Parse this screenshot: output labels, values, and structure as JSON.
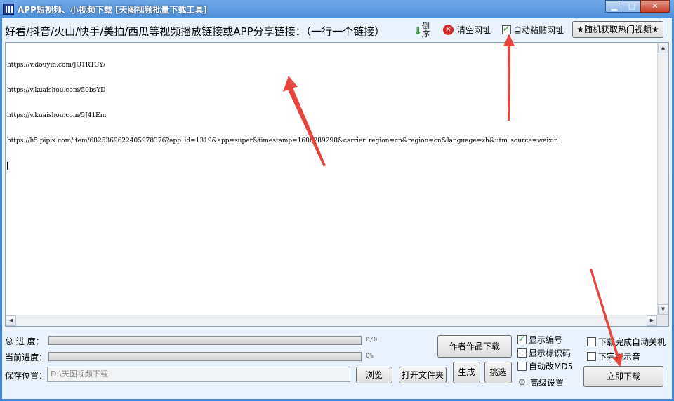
{
  "window": {
    "title": "APP短视频、小视频下载 [天图视频批量下载工具]"
  },
  "toolbar": {
    "prompt": "好看/抖音/火山/快手/美拍/西瓜等视频播放链接或APP分享链接：（一行一个链接）",
    "reverse_label": "倒序",
    "clear_label": "清空网址",
    "auto_paste_label": "自动粘贴网址",
    "auto_paste_checked": true,
    "hot_videos_label": "★随机获取热门视频★"
  },
  "links": [
    "https://v.douyin.com/JQ1RTCY/",
    "https://v.kuaishou.com/50bsYD",
    "https://v.kuaishou.com/5J41Em",
    "https://h5.pipix.com/item/6825369622405978376?app_id=1319&app=super&timestamp=1606289298&carrier_region=cn&region=cn&language=zh&utm_source=weixin"
  ],
  "progress": {
    "total_label": "总 进 度：",
    "total_value": "0/0",
    "total_fraction": 0,
    "current_label": "当前进度：",
    "current_value": "0%",
    "current_fraction": 0
  },
  "save": {
    "label": "保存位置：",
    "path": "D:\\天图视频下载",
    "browse_label": "浏览",
    "open_folder_label": "打开文件夹"
  },
  "actions": {
    "author_download_label": "作者作品下载",
    "generate_label": "生成",
    "pick_label": "挑选",
    "download_now_label": "立即下载"
  },
  "options": {
    "show_number_label": "显示编号",
    "show_number_checked": true,
    "show_id_label": "显示标识码",
    "show_id_checked": false,
    "auto_md5_label": "自动改MD5",
    "auto_md5_checked": false,
    "advanced_label": "高级设置",
    "shutdown_label": "下载完成自动关机",
    "shutdown_checked": false,
    "sound_label": "下完提示音",
    "sound_checked": false
  },
  "icons": {
    "reverse": "down-arrow-icon",
    "clear": "red-x-icon",
    "settings": "gear-icon"
  },
  "colors": {
    "titlebar": "#4a8bd6",
    "client": "#eaf3fd",
    "annotation_arrow": "#e8453c"
  }
}
